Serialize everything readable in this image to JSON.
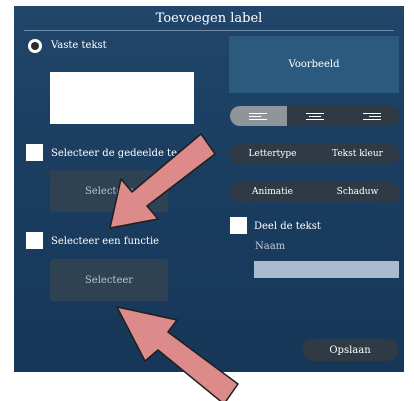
{
  "dialog": {
    "title": "Toevoegen label"
  },
  "left": {
    "fixed_text_label": "Vaste tekst",
    "shared_text_label": "Selecteer de gedeelde te",
    "shared_select_button": "Selecteer",
    "function_label": "Selecteer een functie",
    "function_select_button": "Selecteer"
  },
  "right": {
    "preview_label": "Voorbeeld",
    "align_options": [
      "left",
      "center",
      "right"
    ],
    "font_label": "Lettertype",
    "text_color_label": "Tekst kleur",
    "animation_label": "Animatie",
    "shadow_label": "Schaduw",
    "share_text_label": "Deel de tekst",
    "name_label": "Naam",
    "name_value": "",
    "save_button": "Opslaan"
  },
  "annotation": {
    "arrow_color": "#dc8a8a",
    "arrow_border": "#1f1f1f"
  }
}
